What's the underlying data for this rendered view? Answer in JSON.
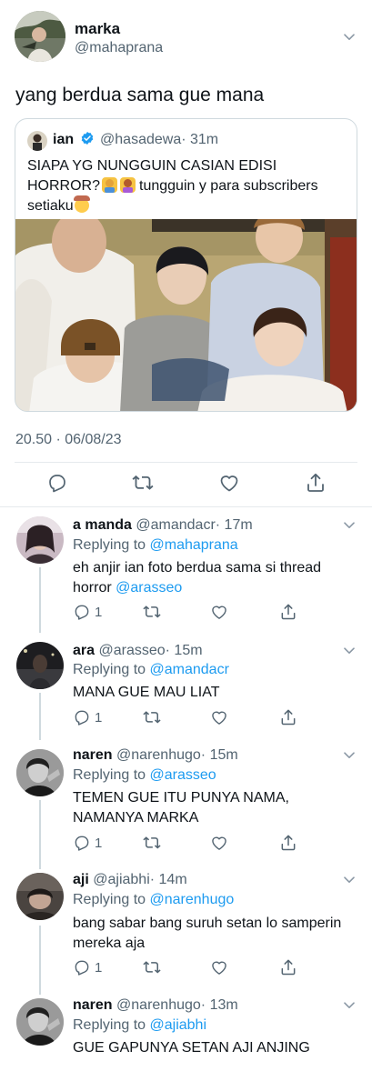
{
  "main_tweet": {
    "name": "marka",
    "handle": "@mahaprana",
    "text": "yang berdua sama gue mana",
    "timestamp": "20.50 · 06/08/23",
    "quote": {
      "name": "ian",
      "handle": "@hasadewa",
      "dot_time": "· 31m",
      "text_line1": "SIAPA YG NUNGGUIN CASIAN EDISI",
      "text_line2a": "HORROR?",
      "text_line2b": "tungguin y para subscribers",
      "text_line3": "setiaku"
    }
  },
  "replies": [
    {
      "name": "a manda",
      "handle": "@amandacr",
      "time": "· 17m",
      "replying_prefix": "Replying to",
      "replying_to": "@mahaprana",
      "line1": "eh anjir ian foto berdua sama si thread",
      "line2a": "horror",
      "line2b": "@arasseo",
      "reply_count": "1"
    },
    {
      "name": "ara",
      "handle": "@arasseo",
      "time": "· 15m",
      "replying_prefix": "Replying to",
      "replying_to": "@amandacr",
      "line1": "MANA GUE MAU LIAT",
      "reply_count": "1"
    },
    {
      "name": "naren",
      "handle": "@narenhugo",
      "time": "· 15m",
      "replying_prefix": "Replying to",
      "replying_to": "@arasseo",
      "line1": "TEMEN GUE ITU PUNYA NAMA,",
      "line2": "NAMANYA MARKA",
      "reply_count": "1"
    },
    {
      "name": "aji",
      "handle": "@ajiabhi",
      "time": "· 14m",
      "replying_prefix": "Replying to",
      "replying_to": "@narenhugo",
      "line1": "bang sabar bang suruh setan lo samperin",
      "line2": "mereka aja",
      "reply_count": "1"
    },
    {
      "name": "naren",
      "handle": "@narenhugo",
      "time": "· 13m",
      "replying_prefix": "Replying to",
      "replying_to": "@ajiabhi",
      "line1": "GUE GAPUNYA SETAN AJI ANJING"
    }
  ],
  "icons": {
    "reply": "reply-icon",
    "retweet": "retweet-icon",
    "like": "heart-icon",
    "share": "share-icon",
    "more": "chevron-down-icon",
    "verified": "verified-badge-icon"
  },
  "colors": {
    "link": "#1d9bf0",
    "secondary": "#536471",
    "text": "#0f1419",
    "verified": "#1d9bf0"
  }
}
